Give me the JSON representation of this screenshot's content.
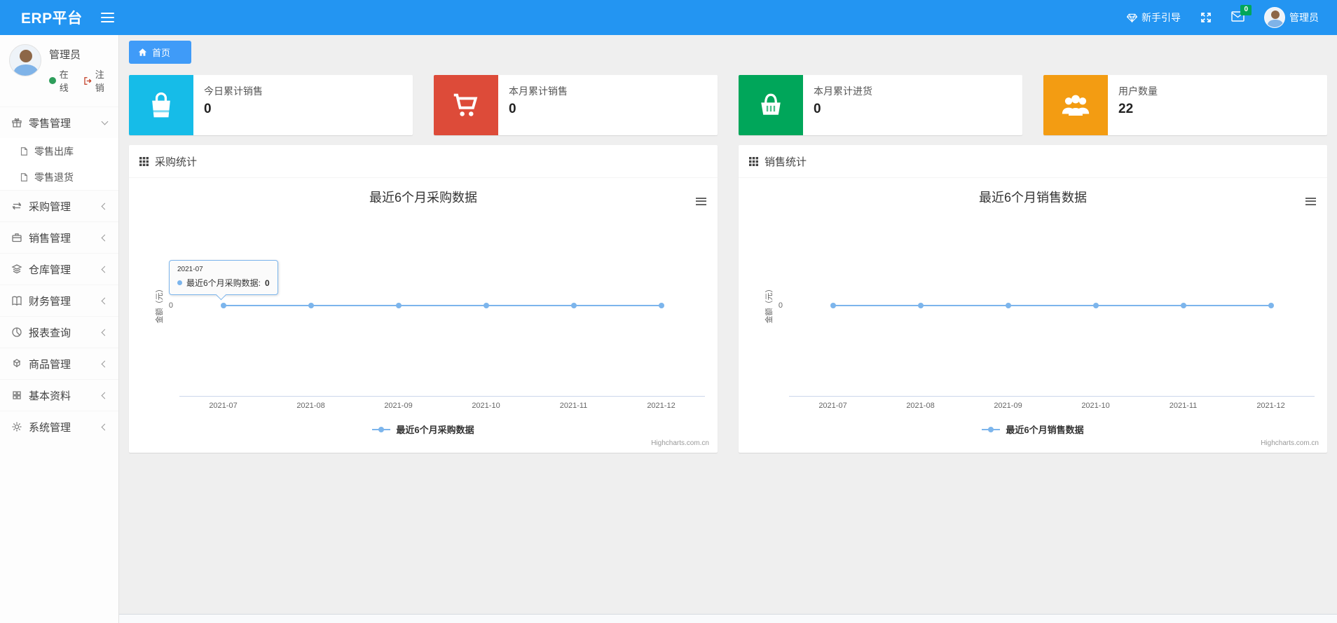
{
  "navbar": {
    "brand": "ERP平台",
    "guide_label": "新手引导",
    "mail_badge": "0",
    "user_name": "管理员"
  },
  "sidebar": {
    "user": {
      "name": "管理员",
      "status": "在线",
      "logout": "注销"
    },
    "menu": {
      "retail": {
        "label": "零售管理"
      },
      "retail_sub_1": {
        "label": "零售出库"
      },
      "retail_sub_2": {
        "label": "零售退货"
      },
      "purchase": {
        "label": "采购管理"
      },
      "sales": {
        "label": "销售管理"
      },
      "warehouse": {
        "label": "仓库管理"
      },
      "finance": {
        "label": "财务管理"
      },
      "reports": {
        "label": "报表查询"
      },
      "goods": {
        "label": "商品管理"
      },
      "basic": {
        "label": "基本资料"
      },
      "system": {
        "label": "系统管理"
      }
    }
  },
  "tabs": {
    "home": "首页"
  },
  "stat_cards": [
    {
      "label": "今日累计销售",
      "value": "0",
      "color": "#16bce8",
      "icon": "shopping-bag-icon"
    },
    {
      "label": "本月累计销售",
      "value": "0",
      "color": "#dd4b39",
      "icon": "cart-icon"
    },
    {
      "label": "本月累计进货",
      "value": "0",
      "color": "#00a65a",
      "icon": "basket-icon"
    },
    {
      "label": "用户数量",
      "value": "22",
      "color": "#f39c12",
      "icon": "users-icon"
    }
  ],
  "chart_data": [
    {
      "type": "line",
      "panel_title": "采购统计",
      "title": "最近6个月采购数据",
      "categories": [
        "2021-07",
        "2021-08",
        "2021-09",
        "2021-10",
        "2021-11",
        "2021-12"
      ],
      "series": [
        {
          "name": "最近6个月采购数据",
          "values": [
            0,
            0,
            0,
            0,
            0,
            0
          ]
        }
      ],
      "xlabel": "",
      "ylabel": "金额（元）",
      "y_ticks": [
        "0"
      ],
      "ylim": [
        -1,
        1
      ],
      "grid": false,
      "legend_position": "bottom",
      "line_color": "#7cb5ec",
      "credits": "Highcharts.com.cn",
      "tooltip": {
        "visible": true,
        "header": "2021-07",
        "series_text": "最近6个月采购数据: ",
        "value": "0"
      }
    },
    {
      "type": "line",
      "panel_title": "销售统计",
      "title": "最近6个月销售数据",
      "categories": [
        "2021-07",
        "2021-08",
        "2021-09",
        "2021-10",
        "2021-11",
        "2021-12"
      ],
      "series": [
        {
          "name": "最近6个月销售数据",
          "values": [
            0,
            0,
            0,
            0,
            0,
            0
          ]
        }
      ],
      "xlabel": "",
      "ylabel": "金额（元）",
      "y_ticks": [
        "0"
      ],
      "ylim": [
        -1,
        1
      ],
      "grid": false,
      "legend_position": "bottom",
      "line_color": "#7cb5ec",
      "credits": "Highcharts.com.cn",
      "tooltip": {
        "visible": false
      }
    }
  ]
}
